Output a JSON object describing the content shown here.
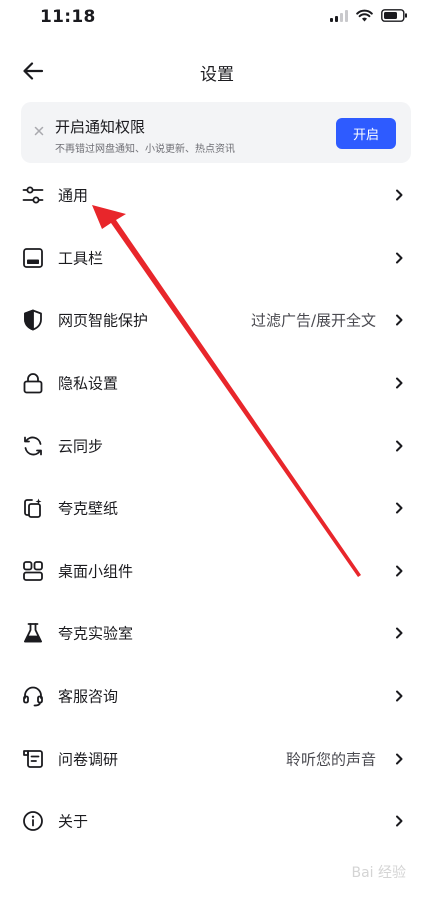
{
  "status_bar": {
    "time": "11:18"
  },
  "nav": {
    "title": "设置",
    "back_icon": "arrow-left-icon"
  },
  "notice": {
    "title": "开启通知权限",
    "subtitle": "不再错过网盘通知、小说更新、热点资讯",
    "button_label": "开启",
    "button_color": "#2e5bff"
  },
  "settings": {
    "items": [
      {
        "label": "通用",
        "value": "",
        "icon": "sliders-icon"
      },
      {
        "label": "工具栏",
        "value": "",
        "icon": "toolbar-icon"
      },
      {
        "label": "网页智能保护",
        "value": "过滤广告/展开全文",
        "icon": "shield-icon"
      },
      {
        "label": "隐私设置",
        "value": "",
        "icon": "lock-icon"
      },
      {
        "label": "云同步",
        "value": "",
        "icon": "sync-icon"
      },
      {
        "label": "夸克壁纸",
        "value": "",
        "icon": "wallpaper-icon"
      },
      {
        "label": "桌面小组件",
        "value": "",
        "icon": "widgets-icon"
      },
      {
        "label": "夸克实验室",
        "value": "",
        "icon": "flask-icon"
      },
      {
        "label": "客服咨询",
        "value": "",
        "icon": "headset-icon"
      },
      {
        "label": "问卷调研",
        "value": "聆听您的声音",
        "icon": "survey-icon"
      },
      {
        "label": "关于",
        "value": "",
        "icon": "info-icon"
      }
    ]
  },
  "annotation": {
    "color": "#e8262b"
  },
  "watermark": {
    "text": "Bai 经验"
  }
}
